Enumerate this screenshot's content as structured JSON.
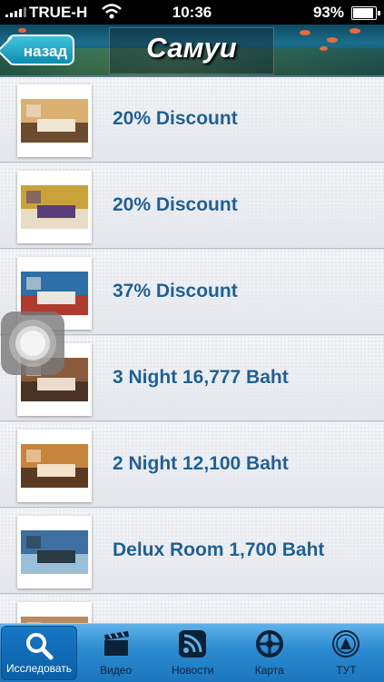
{
  "status_bar": {
    "carrier": "TRUE-H",
    "time": "10:36",
    "battery": "93%"
  },
  "header": {
    "back_label": "назад",
    "title": "Самуи"
  },
  "deals": [
    {
      "label": "20% Discount",
      "thumb_colors": [
        "#d9b070",
        "#f0e6d8",
        "#6d4b2e"
      ]
    },
    {
      "label": "20% Discount",
      "thumb_colors": [
        "#c9a23a",
        "#5a3e7a",
        "#e8dcc6"
      ]
    },
    {
      "label": "37% Discount",
      "thumb_colors": [
        "#2e6fa8",
        "#e8e8e0",
        "#b03a2e"
      ]
    },
    {
      "label": "3 Night 16,777 Baht",
      "thumb_colors": [
        "#8a5a3c",
        "#e9dccb",
        "#4a3324"
      ]
    },
    {
      "label": "2 Night 12,100 Baht",
      "thumb_colors": [
        "#c7843e",
        "#f1e2c8",
        "#5a3a22"
      ]
    },
    {
      "label": "Delux Room 1,700 Baht",
      "thumb_colors": [
        "#3d6fa0",
        "#2a3a44",
        "#9ac0d8"
      ]
    },
    {
      "label": "",
      "thumb_colors": [
        "#b98a5e",
        "#e6d6c2",
        "#6b4a30"
      ]
    }
  ],
  "tab_bar": {
    "tabs": [
      {
        "label": "Исследовать",
        "icon": "search-icon",
        "active": true
      },
      {
        "label": "Видео",
        "icon": "clapperboard-icon",
        "active": false
      },
      {
        "label": "Новости",
        "icon": "rss-icon",
        "active": false
      },
      {
        "label": "Карта",
        "icon": "compass-icon",
        "active": false
      },
      {
        "label": "ТУТ",
        "icon": "tat-logo-icon",
        "active": false
      }
    ]
  },
  "colors": {
    "accent": "#1d5f96",
    "tab_bar": "#2a8ad0",
    "back_button": "#0d8cae"
  }
}
